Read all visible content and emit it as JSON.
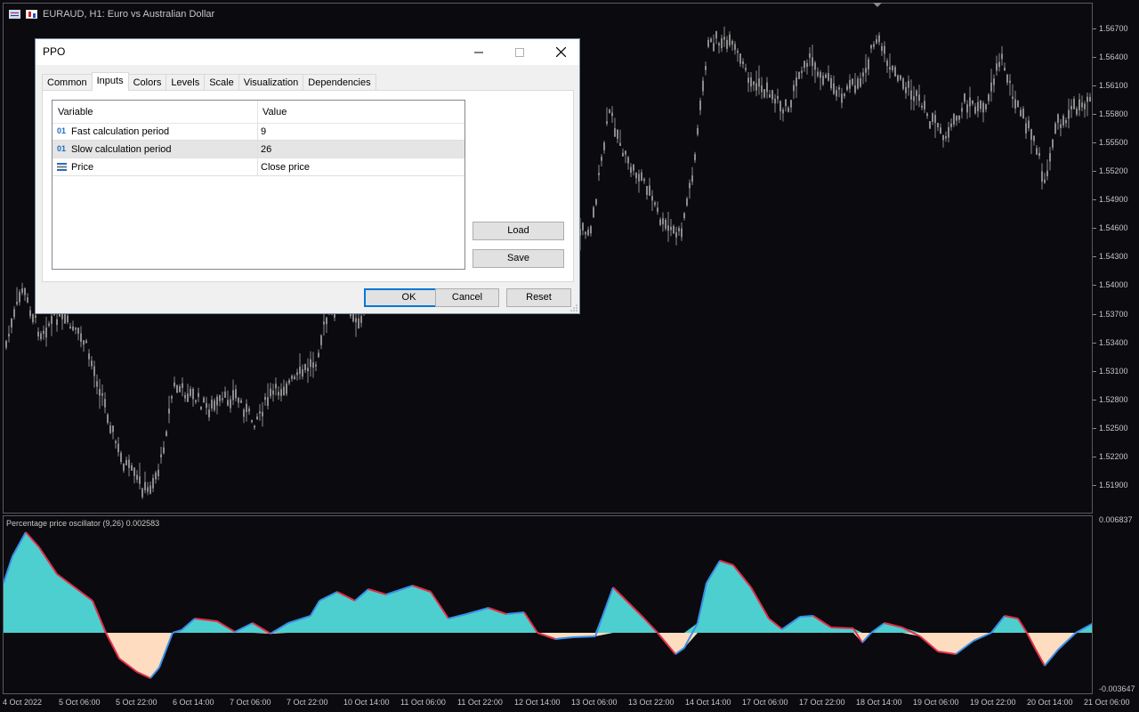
{
  "symbol_bar": {
    "title": "EURAUD, H1:  Euro vs Australian Dollar"
  },
  "price_axis": [
    "1.56700",
    "1.56400",
    "1.56100",
    "1.55800",
    "1.55500",
    "1.55200",
    "1.54900",
    "1.54600",
    "1.54300",
    "1.54000",
    "1.53700",
    "1.53400",
    "1.53100",
    "1.52800",
    "1.52500",
    "1.52200",
    "1.51900"
  ],
  "osc_axis": {
    "top": "0.006837",
    "bottom": "-0.003647"
  },
  "time_axis": [
    "4 Oct 2022",
    "5 Oct 06:00",
    "5 Oct 22:00",
    "6 Oct 14:00",
    "7 Oct 06:00",
    "7 Oct 22:00",
    "10 Oct 14:00",
    "11 Oct 06:00",
    "11 Oct 22:00",
    "12 Oct 14:00",
    "13 Oct 06:00",
    "13 Oct 22:00",
    "14 Oct 14:00",
    "17 Oct 06:00",
    "17 Oct 22:00",
    "18 Oct 14:00",
    "19 Oct 06:00",
    "19 Oct 22:00",
    "20 Oct 14:00",
    "21 Oct 06:00"
  ],
  "indicator": {
    "label": "Percentage price oscillator (9,26) 0.002583"
  },
  "colors": {
    "positive_fill": "#4ecfcf",
    "negative_fill": "#fddcbf",
    "line_up": "#e0304a",
    "line_down": "#3a8fe8",
    "candle": "#8c8c8c"
  },
  "dialog": {
    "title": "PPO",
    "tabs": [
      "Common",
      "Inputs",
      "Colors",
      "Levels",
      "Scale",
      "Visualization",
      "Dependencies"
    ],
    "active_tab": "Inputs",
    "columns": {
      "variable": "Variable",
      "value": "Value"
    },
    "rows": [
      {
        "icon": "01",
        "variable": "Fast calculation period",
        "value": "9"
      },
      {
        "icon": "01",
        "variable": "Slow calculation period",
        "value": "26"
      },
      {
        "icon": "list",
        "variable": "Price",
        "value": "Close price"
      }
    ],
    "load_label": "Load",
    "save_label": "Save",
    "ok_label": "OK",
    "cancel_label": "Cancel",
    "reset_label": "Reset"
  }
}
